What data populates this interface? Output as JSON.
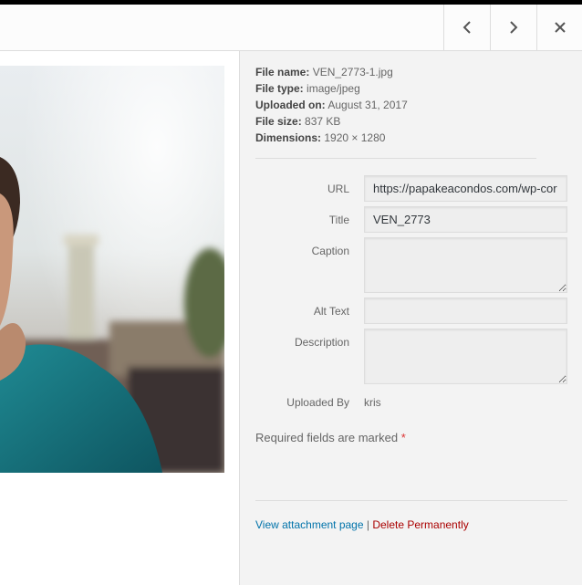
{
  "toolbar": {
    "prev_icon": "chevron-left-icon",
    "next_icon": "chevron-right-icon",
    "close_icon": "close-icon"
  },
  "details": {
    "file_name_label": "File name:",
    "file_name": "VEN_2773-1.jpg",
    "file_type_label": "File type:",
    "file_type": "image/jpeg",
    "uploaded_on_label": "Uploaded on:",
    "uploaded_on": "August 31, 2017",
    "file_size_label": "File size:",
    "file_size": "837 KB",
    "dimensions_label": "Dimensions:",
    "dimensions": "1920 × 1280"
  },
  "settings": {
    "url_label": "URL",
    "url_value": "https://papakeacondos.com/wp-cor",
    "title_label": "Title",
    "title_value": "VEN_2773",
    "caption_label": "Caption",
    "caption_value": "",
    "alt_label": "Alt Text",
    "alt_value": "",
    "description_label": "Description",
    "description_value": "",
    "uploaded_by_label": "Uploaded By",
    "uploaded_by_value": "kris"
  },
  "required_text": "Required fields are marked",
  "required_mark": "*",
  "actions": {
    "view_label": "View attachment page",
    "separator": "|",
    "delete_label": "Delete Permanently"
  },
  "colors": {
    "link": "#0073aa",
    "delete": "#aa0000",
    "required": "#dc3232"
  }
}
